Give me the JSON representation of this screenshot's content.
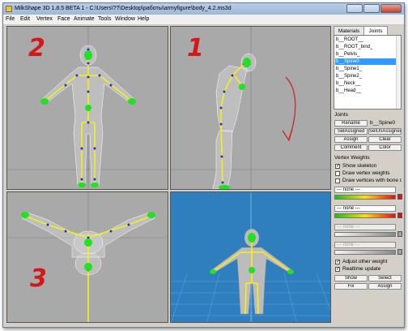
{
  "window": {
    "title": "MilkShape 3D 1.8.5 BETA 1 - C:\\Users\\??\\Desktop\\работы\\armyfigure\\body_4.2.ms3d",
    "title_icon": "milkshape-app-icon",
    "controls": [
      "minimize-button",
      "maximize-button",
      "close-button"
    ]
  },
  "menu": [
    "File",
    "Edit",
    "Vertex",
    "Face",
    "Animate",
    "Tools",
    "Window",
    "Help"
  ],
  "viewports": {
    "front": {
      "annotation": "2"
    },
    "side": {
      "annotation": "1"
    },
    "top": {
      "annotation": "3"
    },
    "perspective": {
      "annotation": ""
    }
  },
  "panel": {
    "tabs": [
      "Materials",
      "Joints"
    ],
    "active_tab": "Joints",
    "joint_list": [
      "b__ROOT__",
      "b__ROOT_bind_",
      "b__Pelvis_",
      "b__Spine0",
      "b__Spine1_",
      "b__Spine2_",
      "b__Neck__",
      "b__Head__"
    ],
    "selected_joint": "b__Spine0",
    "joints_label": "Joints",
    "rename_button": "Rename",
    "joint_name_value": "b__Spine0",
    "sel_assigned_button": "SelAssigned",
    "sel_unassigned_button": "SelUnAssigned",
    "assign_button": "Assign",
    "clear_button": "Clear",
    "comment_button": "Comment",
    "color_button": "Color",
    "vertex_weights_label": "Vertex Weights",
    "show_skeleton_label": "Show skeleton",
    "show_skeleton_checked": true,
    "draw_vertex_weights_label": "Draw vertex weights",
    "draw_vertex_weights_checked": false,
    "draw_vertices_bone_label": "Draw vertices with bone c",
    "draw_vertices_bone_checked": false,
    "weight_selects": [
      "--- none ---",
      "--- none ---",
      "--- none ---",
      "--- none ---"
    ],
    "adjust_other_weight_label": "Adjust other weight",
    "adjust_other_weight_checked": true,
    "realtime_update_label": "Realtime update",
    "realtime_update_checked": true,
    "show_button": "Show",
    "select_button": "Select",
    "fix_button": "Fix",
    "assign_button2": "Assign",
    "grad_green_red": "#18c018",
    "grad_red": "#e01010",
    "grad_yellow": "#ffe000",
    "selected_color": "#3399ff"
  },
  "colors": {
    "viewport_bg": "#a9a9a9",
    "perspective_bg": "#2f7fbf",
    "skeleton": "#f4f01a",
    "annotation": "#d21818"
  }
}
